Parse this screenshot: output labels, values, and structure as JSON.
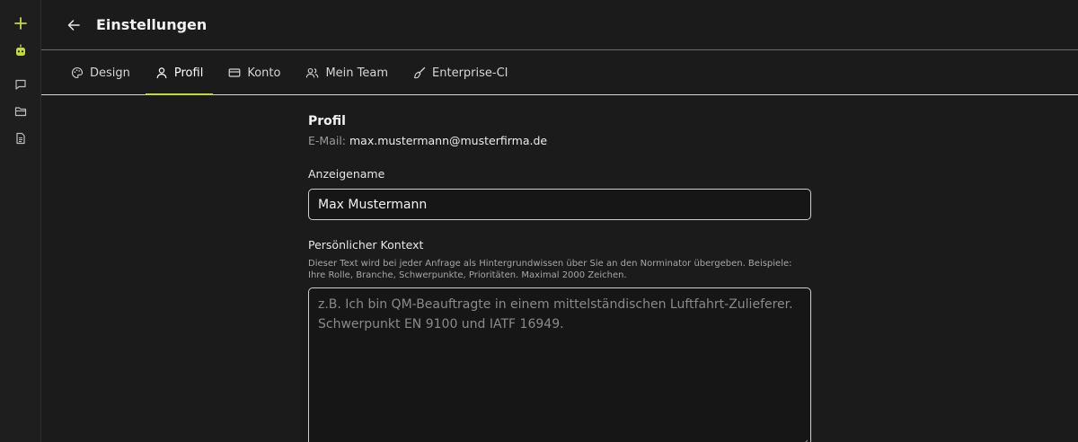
{
  "app": {
    "accent_color": "#c6d93a"
  },
  "rail": {
    "icons": [
      "plus-icon",
      "bot-icon",
      "chat-icon",
      "folder-icon",
      "document-icon"
    ]
  },
  "header": {
    "title": "Einstellungen",
    "back_icon": "arrow-left-icon"
  },
  "tabs": [
    {
      "label": "Design",
      "icon": "palette-icon",
      "active": false
    },
    {
      "label": "Profil",
      "icon": "user-icon",
      "active": true
    },
    {
      "label": "Konto",
      "icon": "credit-card-icon",
      "active": false
    },
    {
      "label": "Mein Team",
      "icon": "users-icon",
      "active": false
    },
    {
      "label": "Enterprise-CI",
      "icon": "brush-icon",
      "active": false
    }
  ],
  "profile": {
    "section_title": "Profil",
    "email_label": "E-Mail:",
    "email_value": "max.mustermann@musterfirma.de",
    "display_name_label": "Anzeigename",
    "display_name_value": "Max Mustermann",
    "context_label": "Persönlicher Kontext",
    "context_help": "Dieser Text wird bei jeder Anfrage als Hintergrundwissen über Sie an den Norminator übergeben. Beispiele: Ihre Rolle, Branche, Schwerpunkte, Prioritäten. Maximal 2000 Zeichen.",
    "context_placeholder": "z.B. Ich bin QM-Beauftragte in einem mittelständischen Luftfahrt-Zulieferer. Schwerpunkt EN 9100 und IATF 16949."
  }
}
